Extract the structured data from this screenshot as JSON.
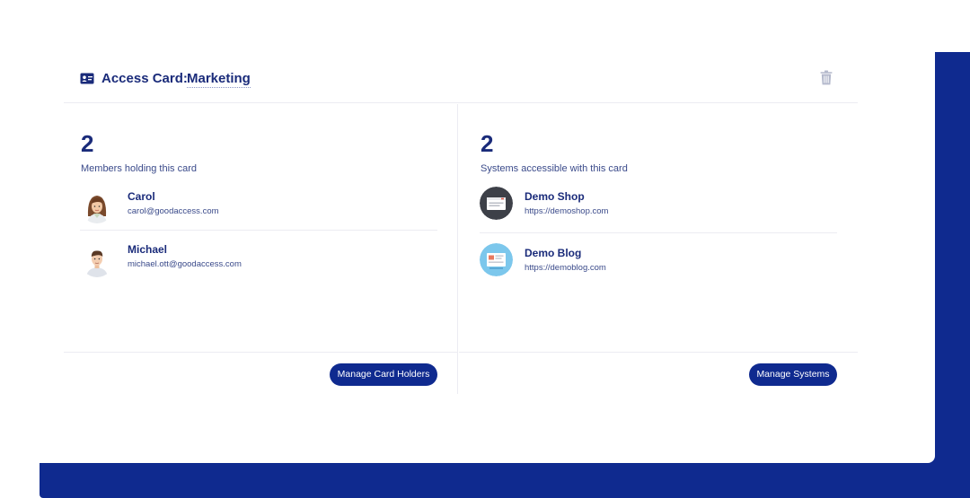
{
  "header": {
    "title_label": "Access Card:",
    "title_value": "Marketing",
    "icons": {
      "card": "id-card-icon",
      "delete": "trash-icon"
    }
  },
  "members": {
    "count": "2",
    "subtitle": "Members holding this card",
    "items": [
      {
        "name": "Carol",
        "email": "carol@goodaccess.com",
        "avatar": "female-avatar"
      },
      {
        "name": "Michael",
        "email": "michael.ott@goodaccess.com",
        "avatar": "male-avatar"
      }
    ],
    "button_label": "Manage Card Holders"
  },
  "systems": {
    "count": "2",
    "subtitle": "Systems accessible with this card",
    "items": [
      {
        "name": "Demo Shop",
        "url": "https://demoshop.com",
        "icon": "shop-system-icon"
      },
      {
        "name": "Demo Blog",
        "url": "https://demoblog.com",
        "icon": "blog-system-icon"
      }
    ],
    "button_label": "Manage Systems"
  },
  "colors": {
    "primary": "#0f2a8f",
    "text": "#1a2b7a",
    "muted": "#3a4a8a",
    "divider": "#ececf2",
    "shop_icon_bg": "#3d4048",
    "blog_icon_bg": "#7cc7ec"
  }
}
